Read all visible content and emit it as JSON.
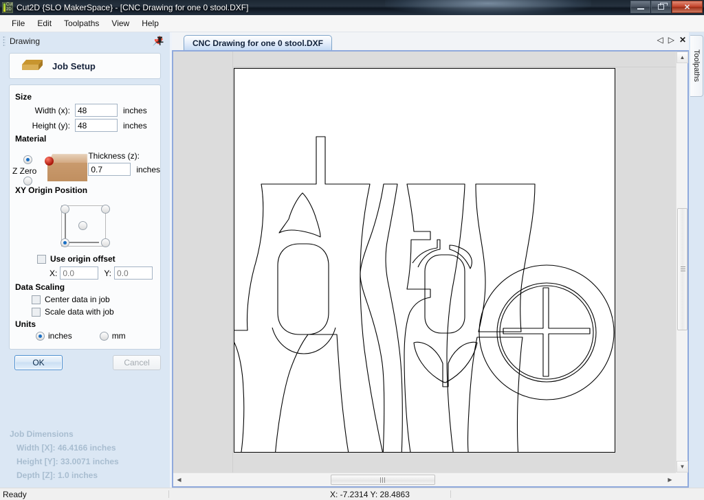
{
  "window": {
    "title": "Cut2D {SLO MakerSpace} - [CNC Drawing for one 0 stool.DXF]",
    "app_icon_text": "Cut\n2D",
    "minimize": "–",
    "maximize": "❐",
    "close": "✕"
  },
  "menu": {
    "items": [
      {
        "label": "File"
      },
      {
        "label": "Edit"
      },
      {
        "label": "Toolpaths"
      },
      {
        "label": "View"
      },
      {
        "label": "Help"
      }
    ]
  },
  "left_panel": {
    "title": "Drawing",
    "pin_icon": "pushpin-icon",
    "job_setup": {
      "label": "Job Setup",
      "icon": "material-block-icon"
    },
    "size": {
      "section_label": "Size",
      "width_label": "Width (x):",
      "width_value": "48",
      "width_units": "inches",
      "height_label": "Height (y):",
      "height_value": "48",
      "height_units": "inches"
    },
    "material": {
      "section_label": "Material",
      "z_zero_label": "Z Zero",
      "z_zero_selected": "top",
      "thickness_label": "Thickness (z):",
      "thickness_value": "0.7",
      "thickness_units": "inches"
    },
    "xy_origin": {
      "section_label": "XY Origin Position",
      "selected": "bottom-left",
      "use_origin_offset_label": "Use origin offset",
      "use_origin_offset_checked": false,
      "x_label": "X:",
      "x_value": "0.0",
      "y_label": "Y:",
      "y_value": "0.0"
    },
    "data_scaling": {
      "section_label": "Data Scaling",
      "center_data_label": "Center data in job",
      "center_data_checked": false,
      "scale_data_label": "Scale data with job",
      "scale_data_checked": false
    },
    "units": {
      "section_label": "Units",
      "inches_label": "inches",
      "mm_label": "mm",
      "selected": "inches"
    },
    "buttons": {
      "ok": "OK",
      "cancel": "Cancel"
    },
    "job_dimensions": {
      "title": "Job Dimensions",
      "width": "Width  [X]: 46.4166 inches",
      "height": "Height [Y]: 33.0071 inches",
      "depth": "Depth  [Z]: 1.0 inches"
    }
  },
  "document": {
    "tab_label": "CNC Drawing for one 0 stool.DXF",
    "nav_prev": "◁",
    "nav_next": "▷",
    "nav_close": "✕"
  },
  "right_dock": {
    "toolpaths_tab": "Toolpaths"
  },
  "status_bar": {
    "ready": "Ready",
    "coordinates": "X: -7.2314 Y: 28.4863"
  },
  "colors": {
    "accent_blue": "#8fa9dc",
    "panel_bg": "#dbe7f4",
    "titlebar_dark": "#1c2733",
    "close_red": "#c4452c",
    "material_tan": "#c99a6d",
    "jobdims_text": "#a8bdd0"
  }
}
